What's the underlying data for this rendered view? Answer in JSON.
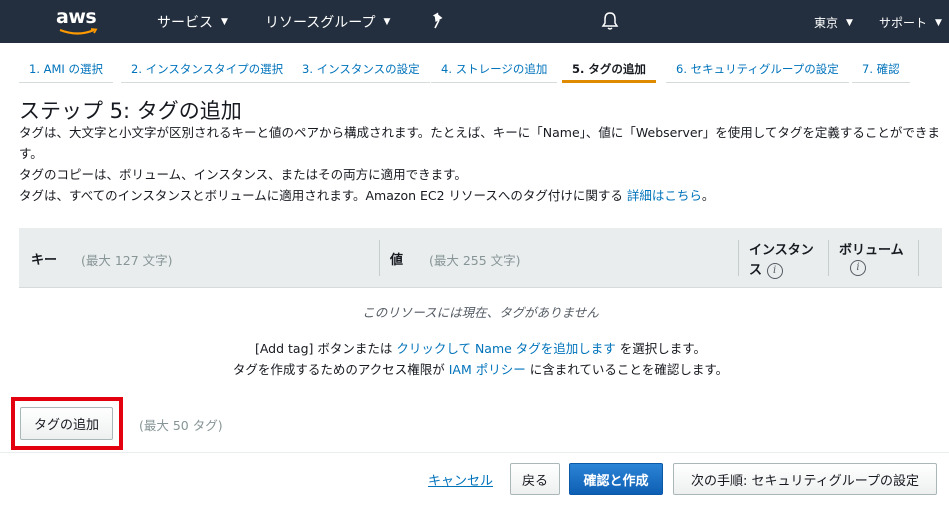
{
  "topnav": {
    "logo": "aws",
    "services": "サービス",
    "resource_groups": "リソースグループ",
    "region": "東京",
    "support": "サポート"
  },
  "steps": [
    {
      "label": "1. AMI の選択",
      "active": false
    },
    {
      "label": "2. インスタンスタイプの選択",
      "active": false
    },
    {
      "label": "3. インスタンスの設定",
      "active": false
    },
    {
      "label": "4. ストレージの追加",
      "active": false
    },
    {
      "label": "5. タグの追加",
      "active": true
    },
    {
      "label": "6. セキュリティグループの設定",
      "active": false
    },
    {
      "label": "7. 確認",
      "active": false
    }
  ],
  "page": {
    "title": "ステップ 5: タグの追加",
    "desc1": "タグは、大文字と小文字が区別されるキーと値のペアから構成されます。たとえば、キーに「Name」、値に「Webserver」を使用してタグを定義することができま",
    "desc1b": "す。",
    "desc2": "タグのコピーは、ボリューム、インスタンス、またはその両方に適用できます。",
    "desc3": "タグは、すべてのインスタンスとボリュームに適用されます。Amazon EC2 リソースへのタグ付けに関する ",
    "desc3_link": "詳細はこちら",
    "desc3_end": "。"
  },
  "table": {
    "key_header": "キー",
    "key_hint": "(最大 127 文字)",
    "value_header": "値",
    "value_hint": "(最大 255 文字)",
    "instance_header_1": "インスタン",
    "instance_header_2": "ス",
    "volume_header": "ボリューム",
    "empty": "このリソースには現在、タグがありません",
    "help1_pre": "[Add tag] ボタンまたは ",
    "help1_link": "クリックして Name タグを追加します",
    "help1_post": " を選択します。",
    "help2_pre": "タグを作成するためのアクセス権限が ",
    "help2_link": "IAM ポリシー",
    "help2_post": " に含まれていることを確認します。"
  },
  "add_tag": {
    "button": "タグの追加",
    "hint": "(最大 50 タグ)"
  },
  "footer": {
    "cancel": "キャンセル",
    "back": "戻る",
    "review_launch": "確認と作成",
    "next": "次の手順: セキュリティグループの設定"
  },
  "colors": {
    "nav_bg": "#232f3e",
    "link": "#0073bb",
    "active_step": "#e08a00",
    "highlight": "#e3000f",
    "primary": "#0e5fb4"
  }
}
